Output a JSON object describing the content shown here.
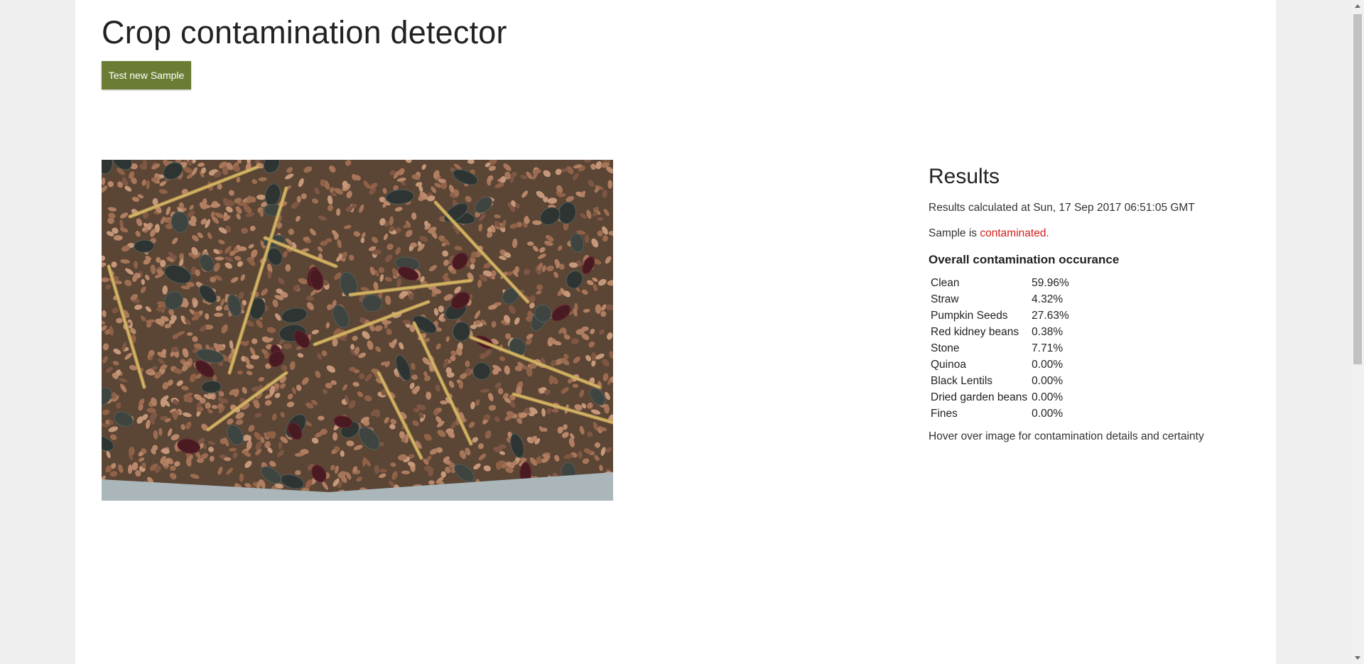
{
  "header": {
    "title": "Crop contamination detector",
    "test_button_label": "Test new Sample"
  },
  "results": {
    "heading": "Results",
    "calculated_text": "Results calculated at Sun, 17 Sep 2017 06:51:05 GMT",
    "status_prefix": "Sample is ",
    "status_value": "contaminated.",
    "overall_heading": "Overall contamination occurance",
    "rows": [
      {
        "label": "Clean",
        "value": "59.96%"
      },
      {
        "label": "Straw",
        "value": "4.32%"
      },
      {
        "label": "Pumpkin Seeds",
        "value": "27.63%"
      },
      {
        "label": "Red kidney beans",
        "value": "0.38%"
      },
      {
        "label": "Stone",
        "value": "7.71%"
      },
      {
        "label": "Quinoa",
        "value": "0.00%"
      },
      {
        "label": "Black Lentils",
        "value": "0.00%"
      },
      {
        "label": "Dried garden beans",
        "value": "0.00%"
      },
      {
        "label": "Fines",
        "value": "0.00%"
      }
    ],
    "hover_hint": "Hover over image for contamination details and certainty"
  },
  "colors": {
    "button_bg": "#6b7d35",
    "contaminated_text": "#d0201a",
    "page_bg": "#efefef"
  }
}
